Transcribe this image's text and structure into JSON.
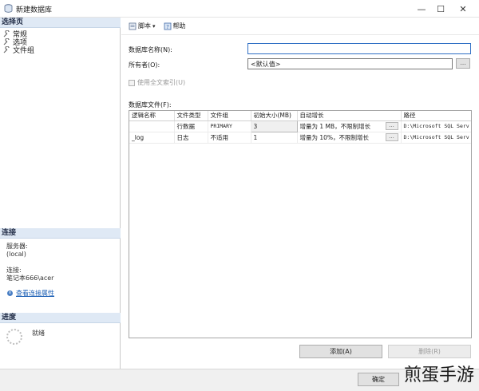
{
  "window": {
    "title": "新建数据库",
    "minimize": "—",
    "maximize": "☐",
    "close": "✕"
  },
  "left": {
    "select_page_header": "选择页",
    "pages": [
      {
        "label": "常规",
        "icon": "page-general-icon"
      },
      {
        "label": "选项",
        "icon": "page-options-icon"
      },
      {
        "label": "文件组",
        "icon": "page-filegroups-icon"
      }
    ],
    "connection_header": "连接",
    "server_label": "服务器:",
    "server_value": "(local)",
    "conn_label": "连接:",
    "conn_value": "笔记本666\\acer",
    "view_conn_props": "查看连接属性",
    "progress_header": "进度",
    "progress_status": "就绪"
  },
  "toolbar": {
    "script_label": "脚本",
    "help_label": "帮助"
  },
  "form": {
    "db_name_label": "数据库名称(N):",
    "db_name_value": "",
    "owner_label": "所有者(O):",
    "owner_value": "<默认值>",
    "fulltext_label": "使用全文索引(U)",
    "files_label": "数据库文件(F):",
    "ellipsis": "..."
  },
  "grid": {
    "columns": [
      "逻辑名称",
      "文件类型",
      "文件组",
      "初始大小(MB)",
      "自动增长",
      "路径"
    ],
    "rows": [
      {
        "logical": "",
        "type": "行数据",
        "group": "PRIMARY",
        "size": "3",
        "growth": "增量为 1 MB，不限制增长",
        "path": "D:\\Microsoft SQL Serv"
      },
      {
        "logical": "_log",
        "type": "日志",
        "group": "不适用",
        "size": "1",
        "growth": "增量为 10%，不限制增长",
        "path": "D:\\Microsoft SQL Serv"
      }
    ]
  },
  "buttons": {
    "add": "添加(A)",
    "remove": "删除(R)",
    "ok_partial": "确定"
  },
  "watermark": "煎蛋手游"
}
